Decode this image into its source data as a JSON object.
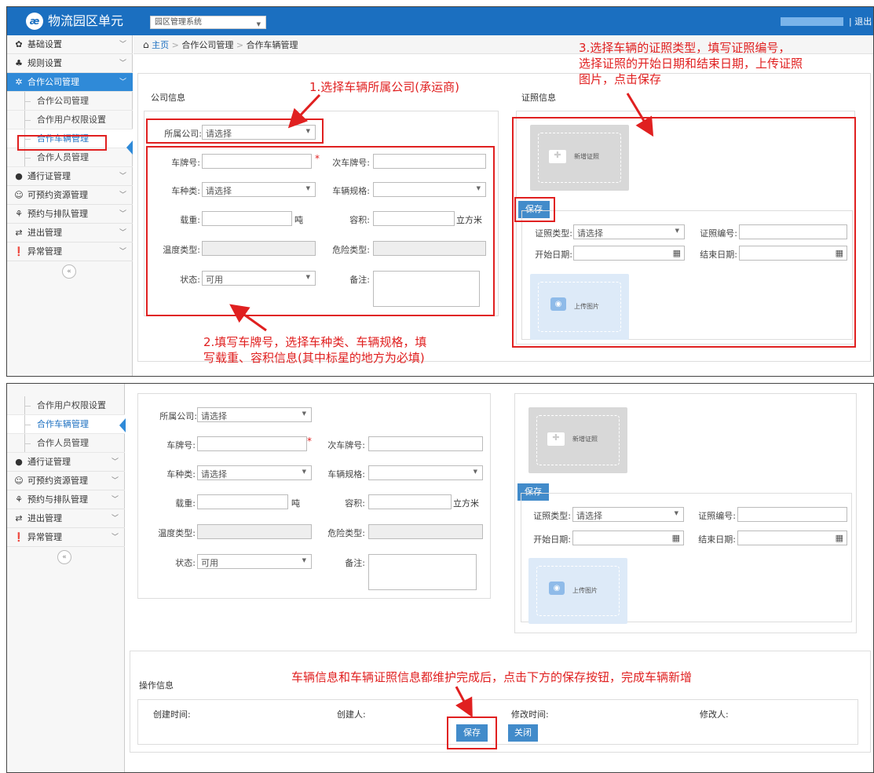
{
  "app": {
    "title": "物流园区单元",
    "system_select": "园区管理系统",
    "logout": "退出"
  },
  "breadcrumb": {
    "home": "主页",
    "sep": ">",
    "level2": "合作公司管理",
    "level3": "合作车辆管理"
  },
  "sidebar": {
    "items": [
      "基础设置",
      "规则设置",
      "合作公司管理",
      "通行证管理",
      "可预约资源管理",
      "预约与排队管理",
      "进出管理",
      "异常管理"
    ],
    "subitems": [
      "合作公司管理",
      "合作用户权限设置",
      "合作车辆管理",
      "合作人员管理"
    ],
    "collapse": "«"
  },
  "sidebar2": {
    "subitems": [
      "合作用户权限设置",
      "合作车辆管理",
      "合作人员管理"
    ],
    "items": [
      "通行证管理",
      "可预约资源管理",
      "预约与排队管理",
      "进出管理",
      "异常管理"
    ]
  },
  "company": {
    "title": "公司信息",
    "label": "所属公司:",
    "placeholder": "请选择"
  },
  "vehicle": {
    "plate": "车牌号:",
    "required": "*",
    "sub_plate": "次车牌号:",
    "type": "车种类:",
    "type_value": "请选择",
    "spec": "车辆规格:",
    "load": "载重:",
    "load_unit": "吨",
    "volume": "容积:",
    "volume_unit": "立方米",
    "temp": "温度类型:",
    "danger": "危险类型:",
    "status": "状态:",
    "status_value": "可用",
    "remark": "备注:"
  },
  "cert": {
    "title": "证照信息",
    "add": "新增证照",
    "save": "保存",
    "type": "证照类型:",
    "type_value": "请选择",
    "number": "证照编号:",
    "start": "开始日期:",
    "end": "结束日期:",
    "upload": "上传图片"
  },
  "operation": {
    "title": "操作信息",
    "created_time": "创建时间:",
    "creator": "创建人:",
    "modified_time": "修改时间:",
    "modifier": "修改人:",
    "save": "保存",
    "close": "关闭"
  },
  "annotations": {
    "a1": "1.选择车辆所属公司(承运商)",
    "a2_line1": "2.填写车牌号，选择车种类、车辆规格，填",
    "a2_line2": "写载重、容积信息(其中标星的地方为必填)",
    "a3_line1": "3.选择车辆的证照类型，填写证照编号，",
    "a3_line2": "选择证照的开始日期和结束日期，上传证照",
    "a3_line3": "图片，点击保存",
    "a4": "车辆信息和车辆证照信息都维护完成后，点击下方的保存按钮，完成车辆新增"
  },
  "colors": {
    "header": "#1b6fc0",
    "accent": "#428bca",
    "annotation": "#e02020"
  }
}
